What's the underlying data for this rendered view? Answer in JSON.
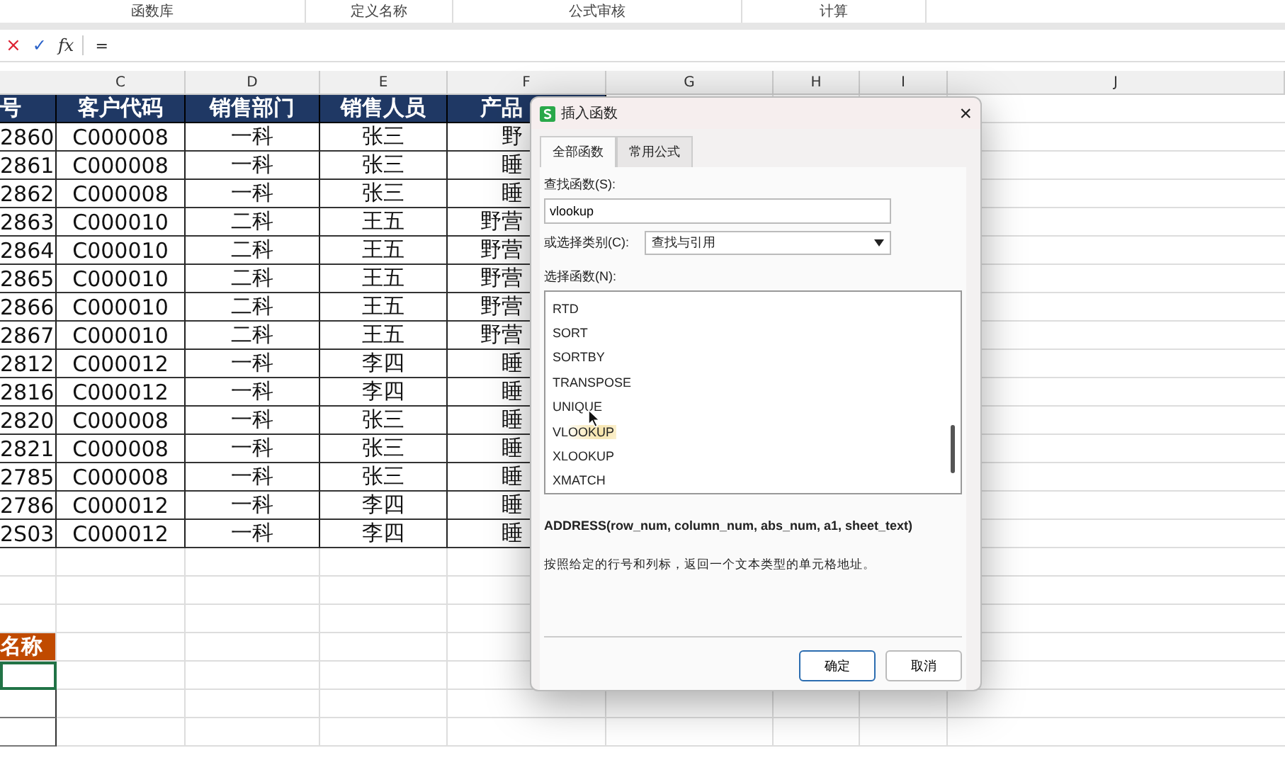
{
  "ribbon_groups": [
    "函数库",
    "定义名称",
    "公式审核",
    "计算"
  ],
  "formula_bar": {
    "cancel": "×",
    "enter": "✓",
    "fx": "fx",
    "content": "="
  },
  "column_headers": [
    "C",
    "D",
    "E",
    "F",
    "G",
    "H",
    "I",
    "J"
  ],
  "table": {
    "columns": [
      "号",
      "客户代码",
      "销售部门",
      "销售人员",
      "产品"
    ],
    "rows": [
      [
        "2860",
        "C000008",
        "一科",
        "张三",
        "野"
      ],
      [
        "2861",
        "C000008",
        "一科",
        "张三",
        "睡"
      ],
      [
        "2862",
        "C000008",
        "一科",
        "张三",
        "睡"
      ],
      [
        "2863",
        "C000010",
        "二科",
        "王五",
        "野营"
      ],
      [
        "2864",
        "C000010",
        "二科",
        "王五",
        "野营"
      ],
      [
        "2865",
        "C000010",
        "二科",
        "王五",
        "野营"
      ],
      [
        "2866",
        "C000010",
        "二科",
        "王五",
        "野营"
      ],
      [
        "2867",
        "C000010",
        "二科",
        "王五",
        "野营"
      ],
      [
        "2812",
        "C000012",
        "一科",
        "李四",
        "睡"
      ],
      [
        "2816",
        "C000012",
        "一科",
        "李四",
        "睡"
      ],
      [
        "2820",
        "C000008",
        "一科",
        "张三",
        "睡"
      ],
      [
        "2821",
        "C000008",
        "一科",
        "张三",
        "睡"
      ],
      [
        "2785",
        "C000008",
        "一科",
        "张三",
        "睡"
      ],
      [
        "2786",
        "C000012",
        "一科",
        "李四",
        "睡"
      ],
      [
        "2S03",
        "C000012",
        "一科",
        "李四",
        "睡"
      ]
    ]
  },
  "lower_table": {
    "header": "名称",
    "cells": [
      {
        "selected": true
      },
      {
        "selected": false
      },
      {
        "selected": false
      }
    ]
  },
  "dialog": {
    "title": "插入函数",
    "close": "×",
    "tabs": [
      {
        "label": "全部函数",
        "selected": true
      },
      {
        "label": "常用公式",
        "selected": false
      }
    ],
    "search_label": "查找函数(S):",
    "search_value": "vlookup",
    "category_label": "或选择类别(C):",
    "category_value": "查找与引用",
    "list_label": "选择函数(N):",
    "functions": [
      {
        "name": "RTD",
        "hovered": false
      },
      {
        "name": "SORT",
        "hovered": false
      },
      {
        "name": "SORTBY",
        "hovered": false
      },
      {
        "name": "TRANSPOSE",
        "hovered": false
      },
      {
        "name": "UNIQUE",
        "hovered": false
      },
      {
        "name": "VLOOKUP",
        "hovered": true
      },
      {
        "name": "XLOOKUP",
        "hovered": false
      },
      {
        "name": "XMATCH",
        "hovered": false
      }
    ],
    "signature": "ADDRESS(row_num, column_num, abs_num, a1, sheet_text)",
    "description": "按照给定的行号和列标，返回一个文本类型的单元格地址。",
    "buttons": [
      {
        "label": "确定",
        "default": true
      },
      {
        "label": "取消",
        "default": false
      }
    ]
  }
}
